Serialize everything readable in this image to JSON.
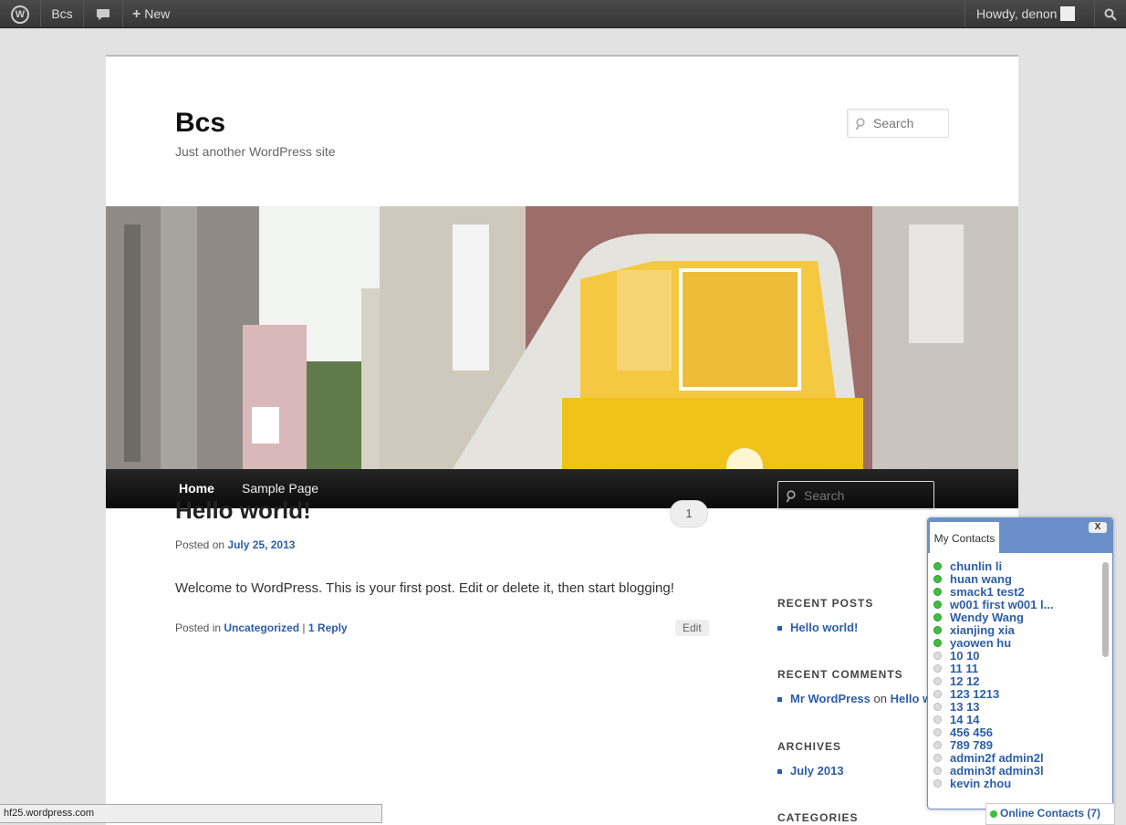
{
  "admin_bar": {
    "site_name": "Bcs",
    "new_label": "New",
    "howdy": "Howdy, denon",
    "icons": [
      "wordpress-logo-icon",
      "comment-icon",
      "plus-icon",
      "search-icon"
    ]
  },
  "site": {
    "title": "Bcs",
    "description": "Just another WordPress site",
    "search_placeholder": "Search"
  },
  "nav": {
    "items": [
      "Home",
      "Sample Page"
    ]
  },
  "post": {
    "title": "Hello world!",
    "comment_count": "1",
    "posted_on_label": "Posted on",
    "date": "July 25, 2013",
    "body": "Welcome to WordPress. This is your first post. Edit or delete it, then start blogging!",
    "posted_in_label": "Posted in",
    "category": "Uncategorized",
    "separator": "|",
    "replies": "1 Reply",
    "edit_label": "Edit"
  },
  "sidebar": {
    "search_placeholder": "Search",
    "recent_posts_title": "RECENT POSTS",
    "recent_posts": [
      "Hello world!"
    ],
    "recent_comments_title": "RECENT COMMENTS",
    "recent_comment_author": "Mr WordPress",
    "recent_comment_on": "on",
    "recent_comment_post": "Hello wo",
    "archives_title": "ARCHIVES",
    "archives": [
      "July 2013"
    ],
    "categories_title": "CATEGORIES"
  },
  "contacts": {
    "tab_label": "My Contacts",
    "close_label": "X",
    "list": [
      {
        "name": "chunlin li",
        "online": true
      },
      {
        "name": "huan wang",
        "online": true
      },
      {
        "name": "smack1 test2",
        "online": true
      },
      {
        "name": "w001 first w001 l...",
        "online": true
      },
      {
        "name": "Wendy Wang",
        "online": true
      },
      {
        "name": "xianjing xia",
        "online": true
      },
      {
        "name": "yaowen hu",
        "online": true
      },
      {
        "name": "10 10",
        "online": false
      },
      {
        "name": "11 11",
        "online": false
      },
      {
        "name": "12 12",
        "online": false
      },
      {
        "name": "123 1213",
        "online": false
      },
      {
        "name": "13 13",
        "online": false
      },
      {
        "name": "14 14",
        "online": false
      },
      {
        "name": "456 456",
        "online": false
      },
      {
        "name": "789 789",
        "online": false
      },
      {
        "name": "admin2f admin2l",
        "online": false
      },
      {
        "name": "admin3f admin3l",
        "online": false
      },
      {
        "name": "kevin zhou",
        "online": false
      }
    ],
    "online_bar": "Online Contacts (7)"
  },
  "status_bar": "hf25.wordpress.com"
}
